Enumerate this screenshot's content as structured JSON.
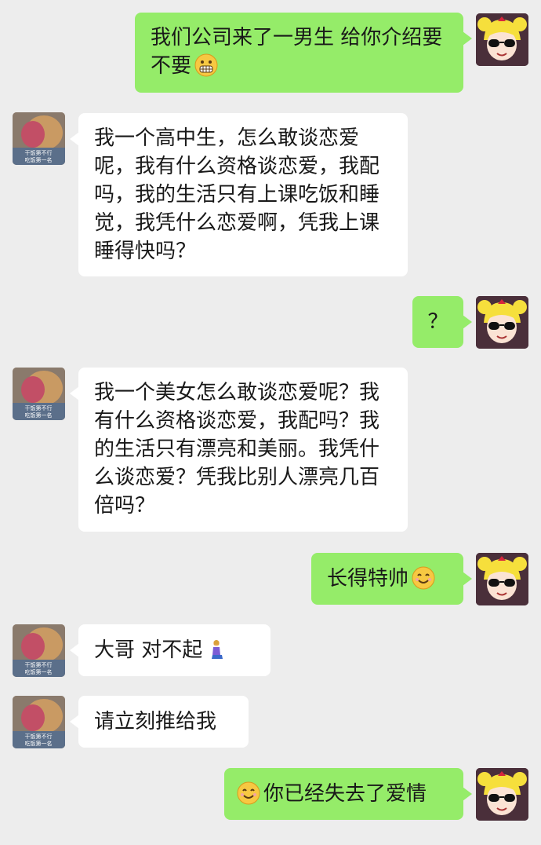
{
  "messages": [
    {
      "sender": "me",
      "text": "我们公司来了一男生 给你介绍要不要",
      "emoji_after": "grimacing-emoji"
    },
    {
      "sender": "friend",
      "text": "我一个高中生，怎么敢谈恋爱呢，我有什么资格谈恋爱，我配吗，我的生活只有上课吃饭和睡觉，我凭什么恋爱啊，凭我上课睡得快吗？"
    },
    {
      "sender": "me",
      "text": "？"
    },
    {
      "sender": "friend",
      "text": "我一个美女怎么敢谈恋爱呢？我有什么资格谈恋爱，我配吗？我的生活只有漂亮和美丽。我凭什么谈恋爱？凭我比别人漂亮几百倍吗？"
    },
    {
      "sender": "me",
      "text": "长得特帅",
      "emoji_after": "smiling-emoji"
    },
    {
      "sender": "friend",
      "text": "大哥 对不起",
      "emoji_after": "kneeling-person-emoji"
    },
    {
      "sender": "friend",
      "text": "请立刻推给我"
    },
    {
      "sender": "me",
      "text": "你已经失去了爱情",
      "emoji_before": "smiling-emoji"
    }
  ],
  "avatars": {
    "friend_caption_line1": "干饭第不行",
    "friend_caption_line2": "吃饭第一名"
  }
}
